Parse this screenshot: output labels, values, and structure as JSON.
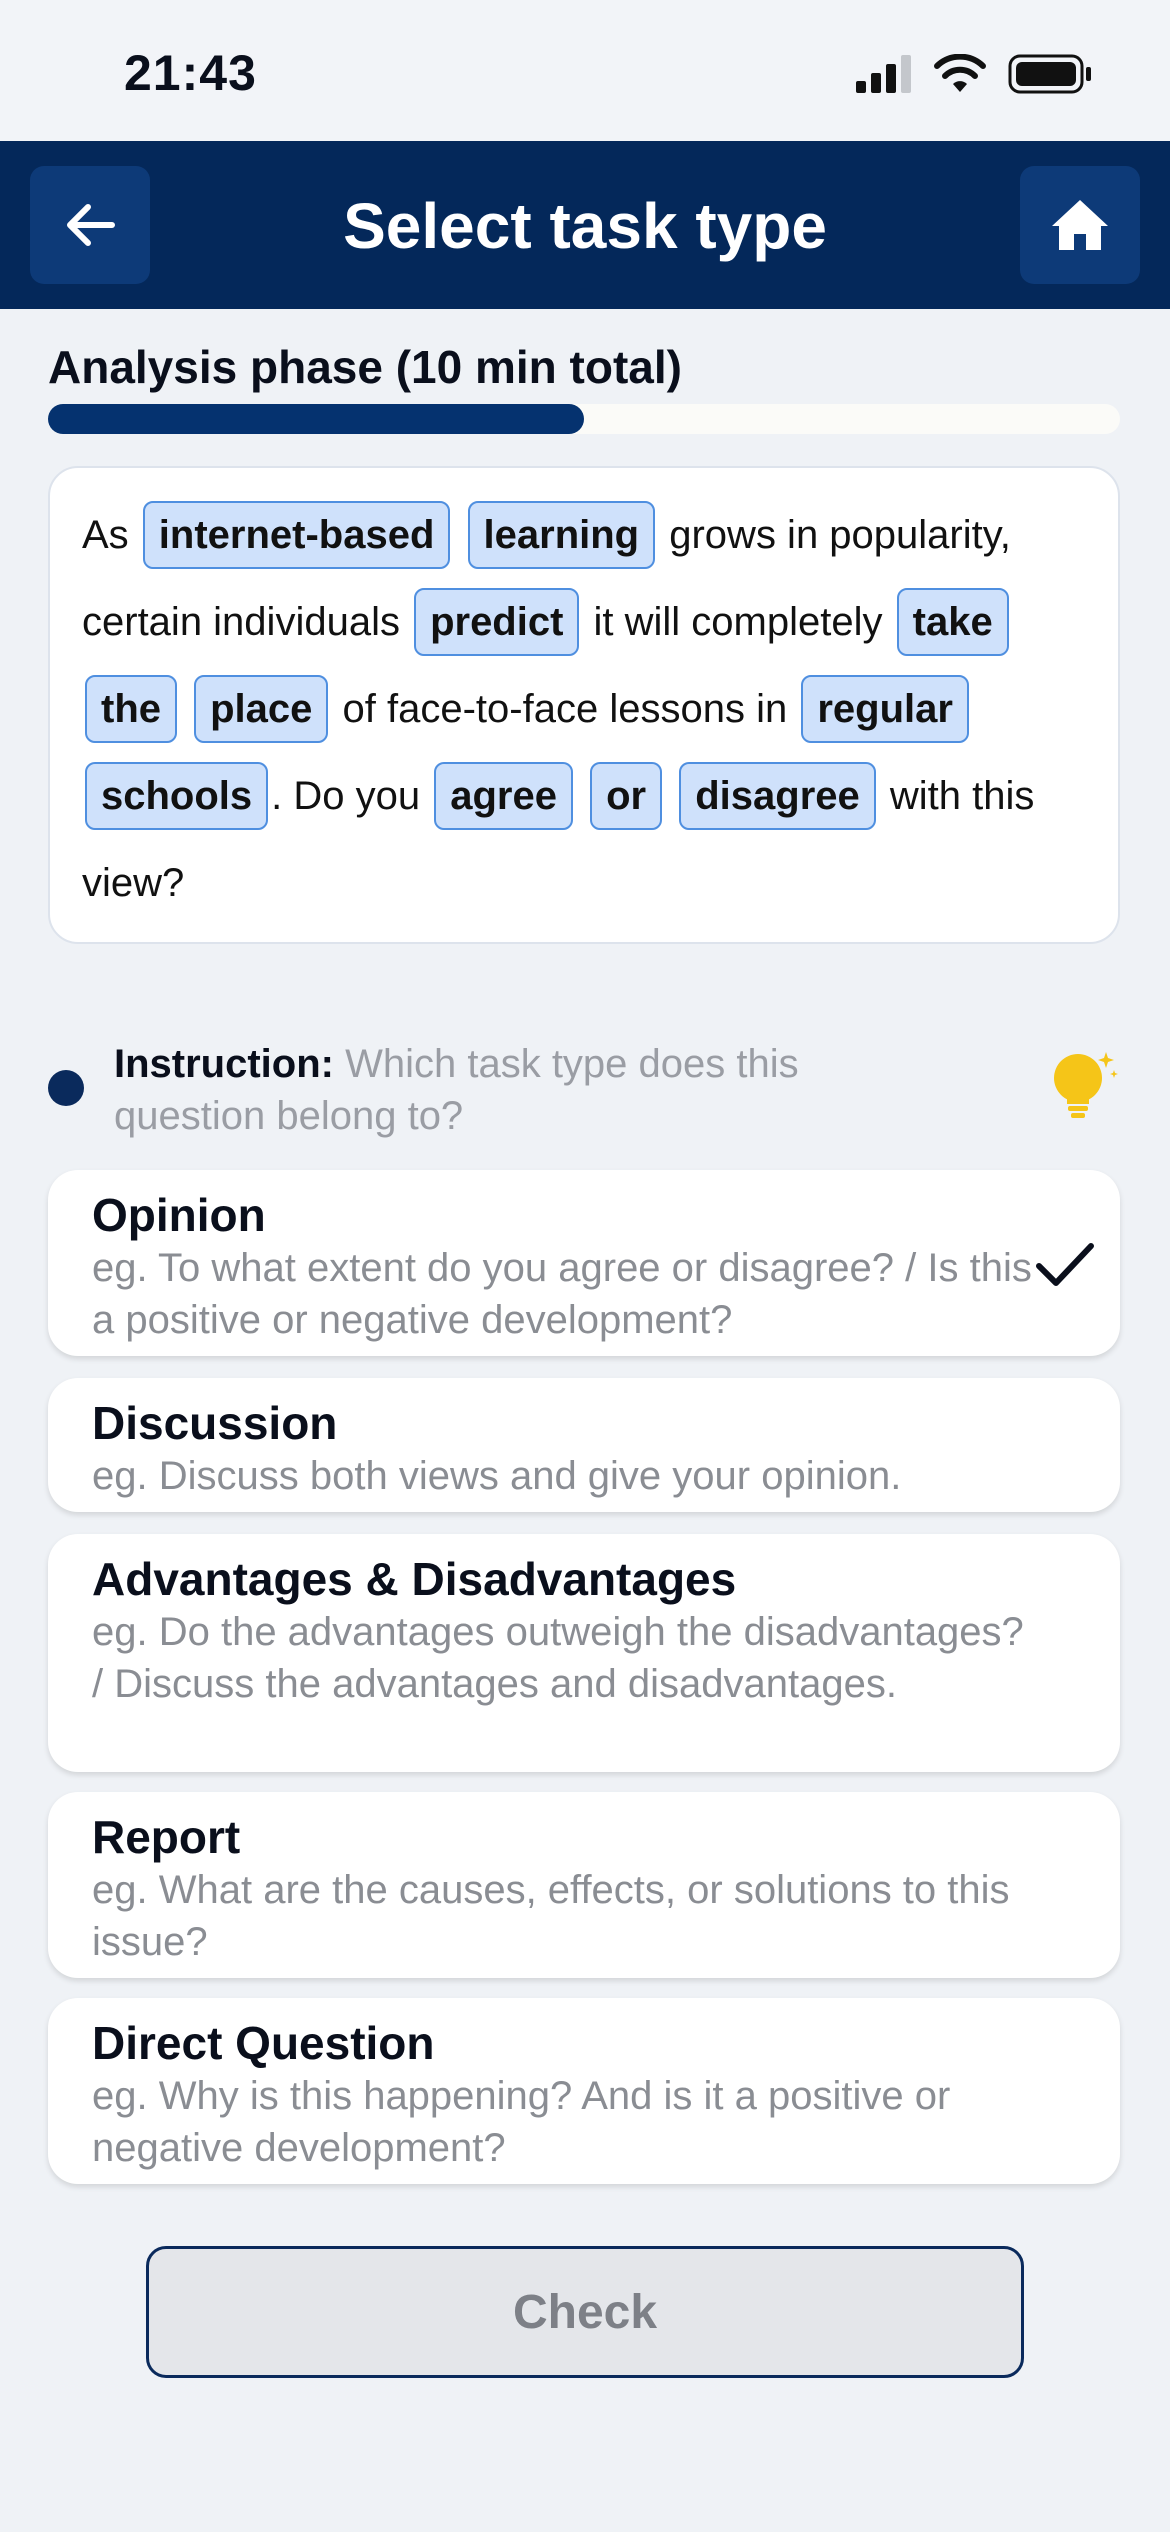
{
  "status_bar": {
    "time": "21:43"
  },
  "nav": {
    "title": "Select task type",
    "back_icon": "arrow-left-icon",
    "home_icon": "home-icon"
  },
  "phase": {
    "title": "Analysis phase (10 min total)",
    "progress": 0.5
  },
  "question": {
    "segments": [
      {
        "text": "As ",
        "kw": false
      },
      {
        "text": "internet-based",
        "kw": true
      },
      {
        "text": " ",
        "kw": false
      },
      {
        "text": "learning",
        "kw": true
      },
      {
        "text": " grows in popularity, certain individuals ",
        "kw": false
      },
      {
        "text": "predict",
        "kw": true
      },
      {
        "text": " it will completely ",
        "kw": false
      },
      {
        "text": "take",
        "kw": true
      },
      {
        "text": " ",
        "kw": false
      },
      {
        "text": "the",
        "kw": true
      },
      {
        "text": " ",
        "kw": false
      },
      {
        "text": "place",
        "kw": true
      },
      {
        "text": " of face-to-face lessons in ",
        "kw": false
      },
      {
        "text": "regular",
        "kw": true
      },
      {
        "text": " ",
        "kw": false
      },
      {
        "text": "schools",
        "kw": true
      },
      {
        "text": ". Do you ",
        "kw": false
      },
      {
        "text": "agree",
        "kw": true
      },
      {
        "text": " ",
        "kw": false
      },
      {
        "text": "or",
        "kw": true
      },
      {
        "text": " ",
        "kw": false
      },
      {
        "text": "disagree",
        "kw": true
      },
      {
        "text": " with this view?",
        "kw": false
      }
    ]
  },
  "instruction": {
    "label": "Instruction:",
    "text": " Which task type does this question belong to?",
    "hint_icon": "lightbulb-icon"
  },
  "options": [
    {
      "title": "Opinion",
      "example": "eg. To what extent do you agree or disagree? / Is this a positive or negative development?",
      "selected": true
    },
    {
      "title": "Discussion",
      "example": "eg. Discuss both views and give your opinion.",
      "selected": false
    },
    {
      "title": "Advantages & Disadvantages",
      "example": "eg. Do the advantages outweigh the disadvantages? / Discuss the advantages and disadvantages.",
      "selected": false
    },
    {
      "title": "Report",
      "example": "eg. What are the causes, effects, or solutions to this issue?",
      "selected": false
    },
    {
      "title": "Direct Question",
      "example": "eg. Why is this happening? And is it a positive or negative development?",
      "selected": false
    }
  ],
  "check_button": {
    "label": "Check"
  },
  "colors": {
    "nav_bg": "#04285a",
    "progress": "#05326f",
    "keyword_bg": "#cfe1fb",
    "keyword_border": "#4f8fe0",
    "bulb": "#f5c518"
  }
}
